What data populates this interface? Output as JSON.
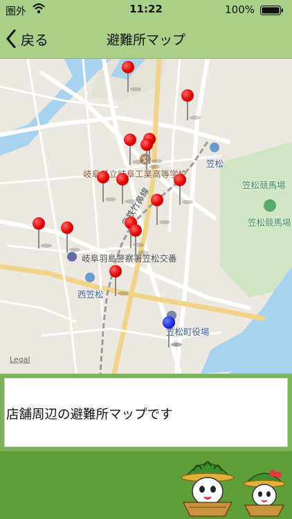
{
  "status": {
    "carrier": "圏外",
    "time": "11:22",
    "battery": "100%"
  },
  "nav": {
    "back_label": "戻る",
    "title": "避難所マップ"
  },
  "map": {
    "labels": {
      "school": "岐阜県立岐阜工業高等学校",
      "rail": "名鉄竹鼻線",
      "kasamatsu_station": "笠松",
      "racecourse_area": "笠松競馬場",
      "racecourse": "笠松競馬場",
      "police": "岐阜羽島警察署笠松交番",
      "nishi_kasamatsu": "西笠松",
      "town_hall": "笠松町役場",
      "legal": "Legal"
    },
    "pins": [
      {
        "color": "red"
      },
      {
        "color": "red"
      },
      {
        "color": "red"
      },
      {
        "color": "red"
      },
      {
        "color": "red"
      },
      {
        "color": "red"
      },
      {
        "color": "red"
      },
      {
        "color": "red"
      },
      {
        "color": "red"
      },
      {
        "color": "red"
      },
      {
        "color": "red"
      },
      {
        "color": "red"
      },
      {
        "color": "red"
      },
      {
        "color": "red"
      },
      {
        "color": "red"
      },
      {
        "color": "blue"
      }
    ]
  },
  "info": {
    "text": "店舗周辺の避難所マップです"
  },
  "colors": {
    "bar": "#a9cf88",
    "footer": "#5f9e38",
    "water": "#a8d3f0",
    "park": "#cfe6c4"
  }
}
